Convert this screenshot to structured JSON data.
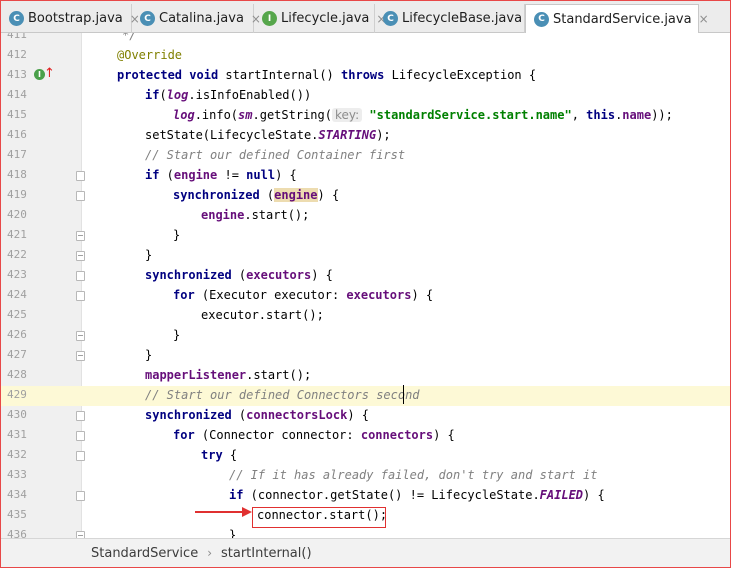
{
  "tabs": [
    {
      "label": "Bootstrap.java",
      "icon": "class",
      "letter": "C",
      "active": false
    },
    {
      "label": "Catalina.java",
      "icon": "class",
      "letter": "C",
      "active": false
    },
    {
      "label": "Lifecycle.java",
      "icon": "interface",
      "letter": "I",
      "active": false
    },
    {
      "label": "LifecycleBase.java",
      "icon": "class",
      "letter": "C",
      "active": false
    },
    {
      "label": "StandardService.java",
      "icon": "class",
      "letter": "C",
      "active": true
    }
  ],
  "tab_close_glyph": "×",
  "code": {
    "line_numbers": [
      "411",
      "412",
      "413",
      "414",
      "415",
      "416",
      "417",
      "418",
      "419",
      "420",
      "421",
      "422",
      "423",
      "424",
      "425",
      "426",
      "427",
      "428",
      "429",
      "430",
      "431",
      "432",
      "433",
      "434",
      "435",
      "436"
    ],
    "l411": "*/",
    "l412_annotation": "@Override",
    "l413": {
      "kw1": "protected",
      "kw2": "void",
      "name": "startInternal()",
      "kw3": "throws",
      "rest": "LifecycleException {"
    },
    "l414": {
      "kw": "if",
      "p1": "(",
      "field": "log",
      "rest": ".isInfoEnabled())"
    },
    "l415": {
      "field": "log",
      "p1": ".info(",
      "field2": "sm",
      "p2": ".getString(",
      "hint": "key:",
      "str": "\"standardService.start.name\"",
      "p3": ", ",
      "kw": "this",
      "p4": ".",
      "field3": "name",
      "p5": "));"
    },
    "l416": {
      "p1": "setState(LifecycleState.",
      "field": "STARTING",
      "p2": ");"
    },
    "l417_comment": "// Start our defined Container first",
    "l418": {
      "kw": "if",
      "p1": " (",
      "field": "engine",
      "p2": " != ",
      "kw2": "null",
      "p3": ") {"
    },
    "l419": {
      "kw": "synchronized",
      "p1": " (",
      "field": "engine",
      "p2": ") {"
    },
    "l420": {
      "field": "engine",
      "p1": ".start();"
    },
    "l421": "}",
    "l422": "}",
    "l423": {
      "kw": "synchronized",
      "p1": " (",
      "field": "executors",
      "p2": ") {"
    },
    "l424": {
      "kw": "for",
      "p1": " (Executor executor: ",
      "field": "executors",
      "p2": ") {"
    },
    "l425": "executor.start();",
    "l426": "}",
    "l427": "}",
    "l428": {
      "field": "mapperListener",
      "p1": ".start();"
    },
    "l429_comment": "// Start our defined Connectors second",
    "l430": {
      "kw": "synchronized",
      "p1": " (",
      "field": "connectorsLock",
      "p2": ") {"
    },
    "l431": {
      "kw": "for",
      "p1": " (Connector connector: ",
      "field": "connectors",
      "p2": ") {"
    },
    "l432": {
      "kw": "try",
      "p1": " {"
    },
    "l433_comment": "// If it has already failed, don't try and start it",
    "l434": {
      "kw": "if",
      "p1": " (connector.getState() != LifecycleState.",
      "field": "FAILED",
      "p2": ") {"
    },
    "l435": "connector.start();",
    "l436": "}"
  },
  "gutter_marker_letter": "I",
  "gutter_up_arrow": "↑",
  "breadcrumb": {
    "items": [
      "StandardService",
      "startInternal()"
    ],
    "separator": "›"
  },
  "colors": {
    "keyword": "#000080",
    "comment": "#808080",
    "string": "#008000",
    "field": "#660e7a",
    "annotation": "#808000",
    "current_line": "#fdf9d6",
    "highlight_box": "#e03030"
  }
}
